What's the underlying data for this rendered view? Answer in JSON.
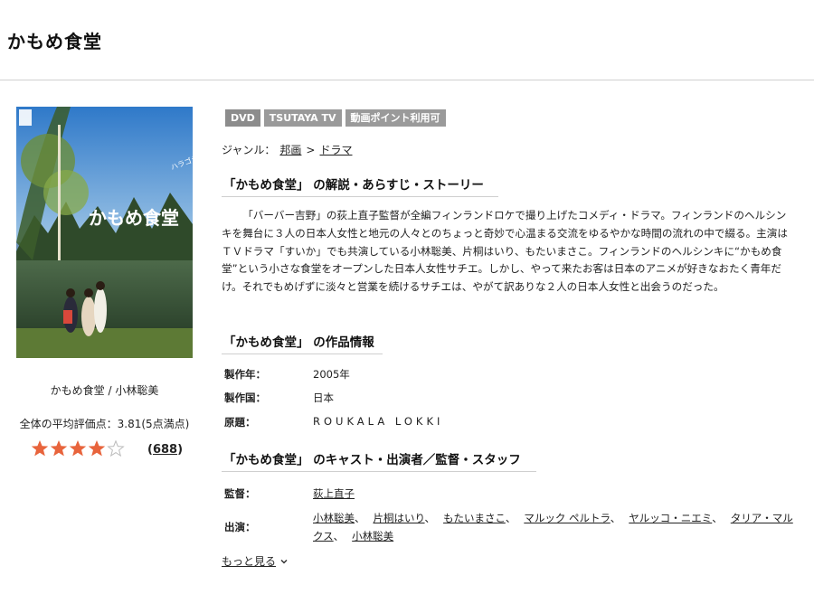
{
  "page": {
    "title": "かもめ食堂"
  },
  "poster": {
    "title_text": "かもめ食堂",
    "caption": "かもめ食堂 / 小林聡美"
  },
  "rating": {
    "average_text": "全体の平均評価点：3.81(5点満点)",
    "stars_filled": 4,
    "stars_total": 5,
    "review_count_open": "(",
    "review_count": "688",
    "review_count_close": ")",
    "star_color": "#e8643c"
  },
  "badges": [
    "DVD",
    "TSUTAYA TV",
    "動画ポイント利用可"
  ],
  "genre": {
    "label": "ジャンル：",
    "level1": "邦画",
    "separator": ">",
    "level2": "ドラマ"
  },
  "synopsis": {
    "heading": "「かもめ食堂」 の解説・あらすじ・ストーリー",
    "text": "「バーバー吉野」の荻上直子監督が全編フィンランドロケで撮り上げたコメディ・ドラマ。フィンランドのヘルシンキを舞台に３人の日本人女性と地元の人々とのちょっと奇妙で心温まる交流をゆるやかな時間の流れの中で綴る。主演はＴＶドラマ「すいか」でも共演している小林聡美、片桐はいり、もたいまさこ。フィンランドのヘルシンキに“かもめ食堂”という小さな食堂をオープンした日本人女性サチエ。しかし、やって来たお客は日本のアニメが好きなおたく青年だけ。それでもめげずに淡々と営業を続けるサチエは、やがて訳ありな２人の日本人女性と出会うのだった。"
  },
  "work_info": {
    "heading": "「かもめ食堂」 の作品情報",
    "rows": [
      {
        "label": "製作年：",
        "value": "2005年"
      },
      {
        "label": "製作国：",
        "value": "日本"
      },
      {
        "label": "原題：",
        "value": "ROUKALA LOKKI"
      }
    ]
  },
  "cast_section": {
    "heading": "「かもめ食堂」 のキャスト・出演者／監督・スタッフ",
    "director_label": "監督：",
    "director": "荻上直子",
    "cast_label": "出演：",
    "cast": [
      "小林聡美",
      "片桐はいり",
      "もたいまさこ",
      "マルック ペルトラ",
      "ヤルッコ・ニエミ",
      "タリア・マルクス",
      "小林聡美"
    ],
    "separator": "、"
  },
  "more_link": {
    "label": "もっと見る"
  }
}
